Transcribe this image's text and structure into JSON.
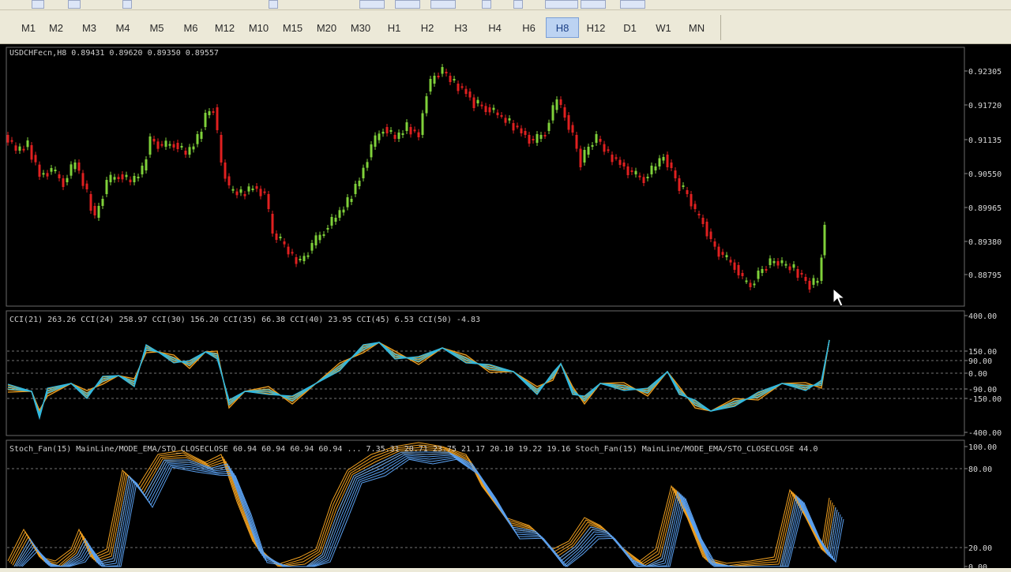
{
  "window": {
    "symbol_info": "USDCHFecn,H8  0.89431 0.89620 0.89350 0.89557"
  },
  "timeframes": [
    {
      "label": "M1",
      "active": false
    },
    {
      "label": "M2",
      "active": false
    },
    {
      "label": "M3",
      "active": false
    },
    {
      "label": "M4",
      "active": false
    },
    {
      "label": "M5",
      "active": false
    },
    {
      "label": "M6",
      "active": false
    },
    {
      "label": "M12",
      "active": false
    },
    {
      "label": "M10",
      "active": false
    },
    {
      "label": "M15",
      "active": false
    },
    {
      "label": "M20",
      "active": false
    },
    {
      "label": "M30",
      "active": false
    },
    {
      "label": "H1",
      "active": false
    },
    {
      "label": "H2",
      "active": false
    },
    {
      "label": "H3",
      "active": false
    },
    {
      "label": "H4",
      "active": false
    },
    {
      "label": "H6",
      "active": false
    },
    {
      "label": "H8",
      "active": true
    },
    {
      "label": "H12",
      "active": false
    },
    {
      "label": "D1",
      "active": false
    },
    {
      "label": "W1",
      "active": false
    },
    {
      "label": "MN",
      "active": false
    }
  ],
  "price_pane": {
    "axis_labels": [
      "0.92305",
      "0.91720",
      "0.91135",
      "0.90550",
      "0.89965",
      "0.89380",
      "0.88795"
    ],
    "colors": {
      "up": "#7fd13a",
      "down": "#e02020"
    }
  },
  "cci_pane": {
    "label": "CCI(21) 263.26  CCI(24) 258.97  CCI(30) 156.20  CCI(35) 66.38  CCI(40) 23.95  CCI(45) 6.53  CCI(50) -4.83",
    "axis_labels": [
      "400.00",
      "150.00",
      "90.00",
      "0.00",
      "-90.00",
      "-150.00",
      "-400.00"
    ],
    "colors": {
      "fast": "#f0a020",
      "slow": "#30b8e0"
    }
  },
  "stoch_pane": {
    "label": "Stoch_Fan(15) MainLine/MODE_EMA/STO_CLOSECLOSE 60.94 60.94 60.94 60.94  ...  7.35.31 20.71 23.75 21.17 20.10 19.22 19.16 Stoch_Fan(15) MainLine/MODE_EMA/STO_CLOSECLOSE 44.0",
    "axis_labels": [
      "100.00",
      "80.00",
      "20.00",
      "0.00"
    ],
    "colors": {
      "fast": "#f0a020",
      "slow": "#5aa0f0"
    }
  }
}
